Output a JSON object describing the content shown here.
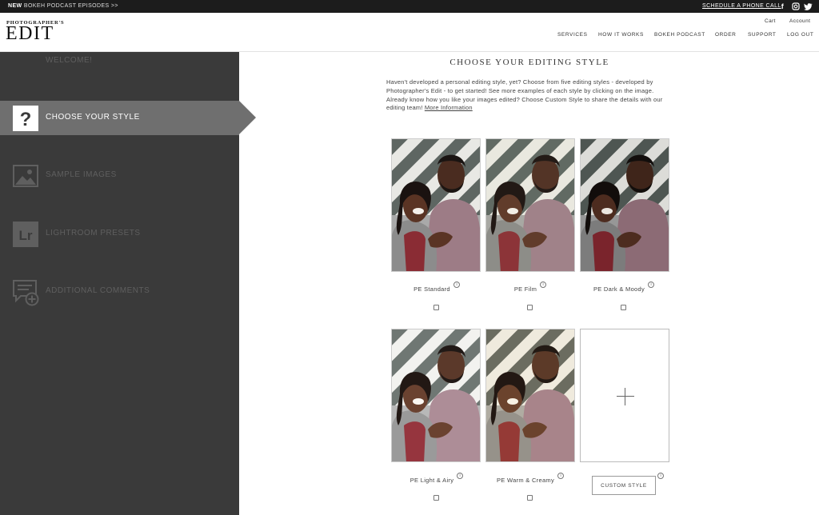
{
  "topbar": {
    "promo_new": "NEW",
    "promo_text": "BOKEH PODCAST EPISODES >>",
    "schedule": "SCHEDULE A PHONE CALL",
    "social": [
      "facebook-icon",
      "instagram-icon",
      "twitter-icon"
    ]
  },
  "header": {
    "logo_small": "PHOTOGRAPHER'S",
    "logo_big": "EDIT",
    "utility": {
      "cart": "Cart",
      "account": "Account"
    },
    "nav": [
      "SERVICES",
      "HOW IT WORKS",
      "BOKEH PODCAST",
      "ORDER",
      "SUPPORT",
      "LOG OUT"
    ]
  },
  "sidebar": {
    "welcome": "WELCOME!",
    "steps": [
      {
        "label": "CHOOSE YOUR STYLE",
        "icon": "question-icon",
        "active": true
      },
      {
        "label": "SAMPLE IMAGES",
        "icon": "image-icon",
        "active": false
      },
      {
        "label": "LIGHTROOM PRESETS",
        "icon": "lightroom-icon",
        "active": false
      },
      {
        "label": "ADDITIONAL COMMENTS",
        "icon": "comment-add-icon",
        "active": false
      }
    ]
  },
  "main": {
    "title": "CHOOSE YOUR EDITING STYLE",
    "intro": "Haven't developed a personal editing style, yet? Choose from five editing styles - developed by Photographer's Edit - to get started! See more examples of each style by clicking on the image. Already know how you like your images edited? Choose Custom Style to share the details with our editing team!",
    "more_info": "More Information",
    "styles": [
      {
        "label": "PE Standard",
        "info": "i"
      },
      {
        "label": "PE Film",
        "info": "i"
      },
      {
        "label": "PE Dark & Moody",
        "info": "i"
      },
      {
        "label": "PE Light & Airy",
        "info": "i"
      },
      {
        "label": "PE Warm & Creamy",
        "info": "i"
      }
    ],
    "custom_button": "CUSTOM STYLE",
    "custom_info": "i"
  },
  "colors": {
    "sidebar_bg": "#3a3a3a",
    "active_step": "#6f6f6f",
    "topbar_bg": "#1c1c1c"
  }
}
